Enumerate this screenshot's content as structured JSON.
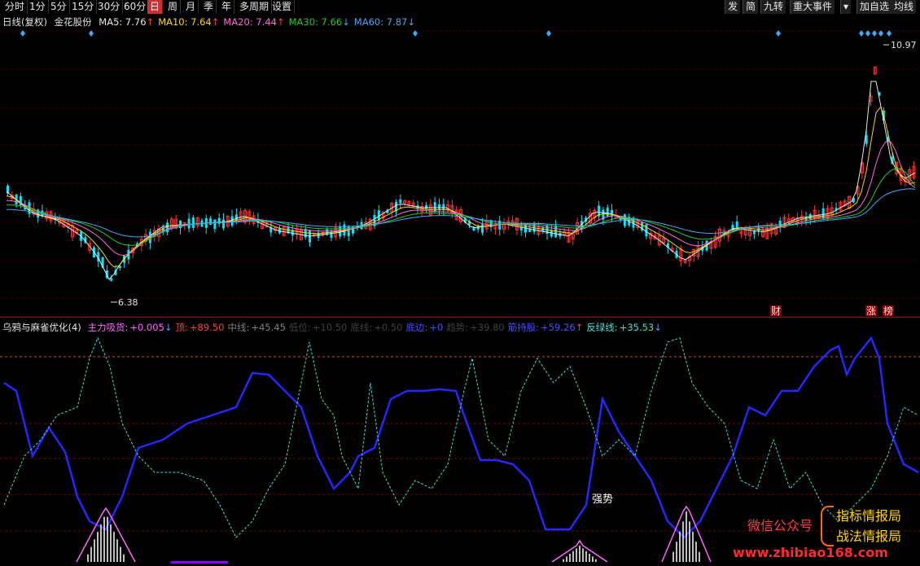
{
  "toolbar": {
    "periods": [
      "分时",
      "1分",
      "5分",
      "15分",
      "30分",
      "60分",
      "日",
      "周",
      "月",
      "季",
      "年",
      "多周期",
      "设置"
    ],
    "active_period": "日",
    "right_buttons": [
      "发",
      "简",
      "九转",
      "重大事件",
      "▾",
      "加自选",
      "均线"
    ]
  },
  "info": {
    "period_label": "日线(复权)",
    "stock_name": "金花股份",
    "ma": [
      {
        "label": "MA5: 7.76",
        "arrow": "↑",
        "color": "#e6e6e6"
      },
      {
        "label": "MA10: 7.64",
        "arrow": "↑",
        "color": "#ffd700"
      },
      {
        "label": "MA20: 7.44",
        "arrow": "↑",
        "color": "#ff6ad5"
      },
      {
        "label": "MA30: 7.66",
        "arrow": "↓",
        "color": "#26c926"
      },
      {
        "label": "MA60: 7.87",
        "arrow": "↓",
        "color": "#3fa9f5"
      }
    ]
  },
  "price_labels": {
    "high": "10.97",
    "low": "6.38"
  },
  "event_markers": [
    "财",
    "涨",
    "榜"
  ],
  "indicator": {
    "name": "乌鸦与麻雀优化(4)",
    "items": [
      {
        "label": "主力吸货:",
        "value": "+0.005",
        "arrow": "↓",
        "color": "#ff66ff"
      },
      {
        "label": "顶:",
        "value": "+89.50",
        "arrow": "",
        "color": "#ff4040"
      },
      {
        "label": "中线:",
        "value": "+45.45",
        "arrow": "",
        "color": "#7f7f7f"
      },
      {
        "label": "低位:",
        "value": "+10.50",
        "arrow": "",
        "color": "#404040"
      },
      {
        "label": "底线:",
        "value": "+0.50",
        "arrow": "",
        "color": "#404040"
      },
      {
        "label": "底边:",
        "value": "+0",
        "arrow": "",
        "color": "#4d4dff"
      },
      {
        "label": "趋势:",
        "value": "+39.80",
        "arrow": "",
        "color": "#404040"
      },
      {
        "label": "筋持股:",
        "value": "+59.26",
        "arrow": "↑",
        "color": "#4d4dff"
      },
      {
        "label": "反绿线:",
        "value": "+35.53",
        "arrow": "↓",
        "color": "#40e0d0"
      }
    ],
    "annotation": "强势"
  },
  "watermark": {
    "wechat": "微信公众号",
    "name1": "指标情报局",
    "name2": "战法情报局",
    "site": "www.zhibiao168.com"
  }
}
